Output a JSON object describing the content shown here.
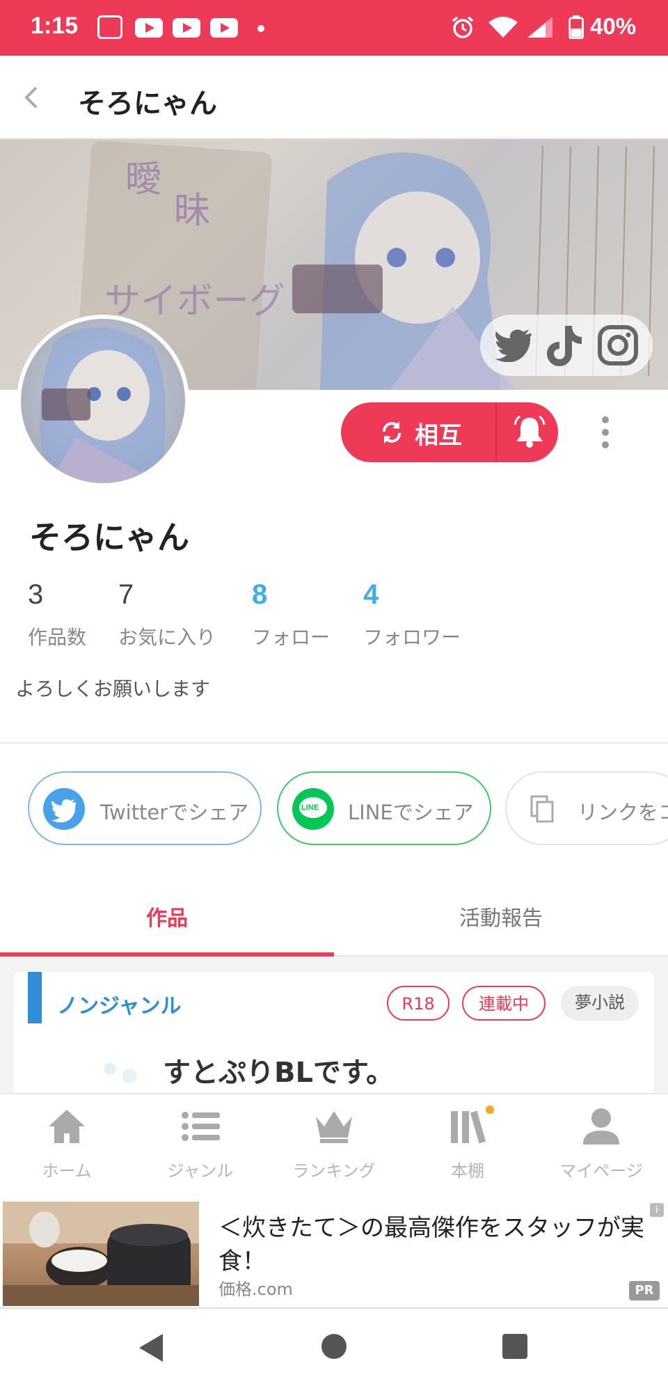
{
  "status_bar": {
    "time": "1:15",
    "battery": "40%"
  },
  "header": {
    "title": "そろにゃん"
  },
  "profile": {
    "name": "そろにゃん",
    "follow_label": "相互",
    "bio": "よろしくお願いします",
    "stats": [
      {
        "value": "3",
        "label": "作品数"
      },
      {
        "value": "7",
        "label": "お気に入り"
      },
      {
        "value": "8",
        "label": "フォロー"
      },
      {
        "value": "4",
        "label": "フォロワー"
      }
    ]
  },
  "share": {
    "twitter": "Twitterでシェア",
    "line": "LINEでシェア",
    "line_badge": "LINE",
    "link": "リンクをコ"
  },
  "tabs": [
    {
      "label": "作品",
      "active": true
    },
    {
      "label": "活動報告",
      "active": false
    }
  ],
  "work": {
    "genre": "ノンジャンル",
    "tags": [
      "R18",
      "連載中",
      "夢小説"
    ],
    "title": "すとぷりBLです。"
  },
  "bottom_nav": [
    {
      "label": "ホーム",
      "icon": "home-icon"
    },
    {
      "label": "ジャンル",
      "icon": "list-icon"
    },
    {
      "label": "ランキング",
      "icon": "crown-icon"
    },
    {
      "label": "本棚",
      "icon": "bookshelf-icon"
    },
    {
      "label": "マイページ",
      "icon": "person-icon"
    }
  ],
  "ad": {
    "headline": "＜炊きたて＞の最高傑作をスタッフが実食！",
    "source": "価格.com",
    "pr": "PR",
    "info": "i"
  },
  "colors": {
    "accent": "#ef3a57",
    "blue": "#3cb0e6",
    "genre_blue": "#2f8ed6",
    "line_green": "#06c755",
    "twitter_blue": "#4aa1eb"
  }
}
